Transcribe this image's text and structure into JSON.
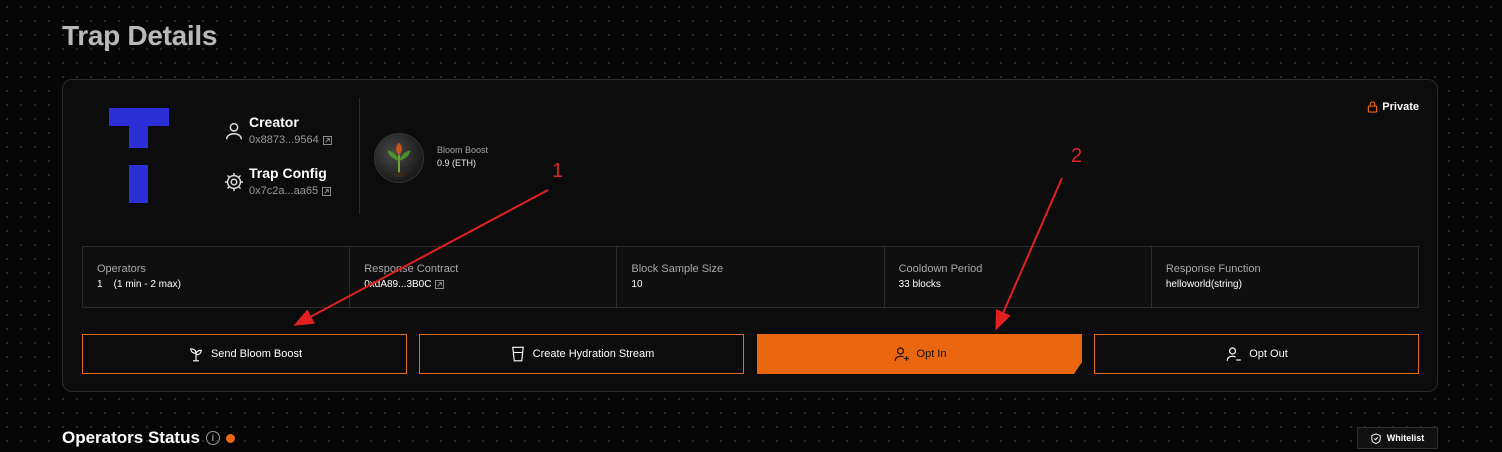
{
  "page": {
    "title": "Trap Details"
  },
  "trap": {
    "creator_label": "Creator",
    "creator_address": "0x8873...9564",
    "config_label": "Trap Config",
    "config_address": "0x7c2a...aa65",
    "privacy": "Private"
  },
  "bloom_boost": {
    "label": "Bloom Boost",
    "value": "0.9 (ETH)"
  },
  "stats": [
    {
      "label": "Operators",
      "value": "1    (1 min - 2 max)"
    },
    {
      "label": "Response Contract",
      "value": "0xdA89...3B0C"
    },
    {
      "label": "Block Sample Size",
      "value": "10"
    },
    {
      "label": "Cooldown Period",
      "value": "33 blocks"
    },
    {
      "label": "Response Function",
      "value": "helloworld(string)"
    }
  ],
  "actions": {
    "send_bloom_boost": "Send Bloom Boost",
    "create_hydration_stream": "Create Hydration Stream",
    "opt_in": "Opt In",
    "opt_out": "Opt Out"
  },
  "annotations": {
    "first": "1",
    "second": "2"
  },
  "operators_status": {
    "title": "Operators Status",
    "info_glyph": "i"
  },
  "whitelist": {
    "label": "Whitelist"
  },
  "colors": {
    "accent": "#ea6710",
    "logo": "#2d2fd6",
    "annotation": "#e12121"
  },
  "icons": [
    "user-icon",
    "gear-icon",
    "external-link-icon",
    "lock-icon",
    "sprout-icon",
    "cup-icon",
    "user-plus-icon",
    "user-minus-icon",
    "info-icon",
    "shield-icon"
  ]
}
